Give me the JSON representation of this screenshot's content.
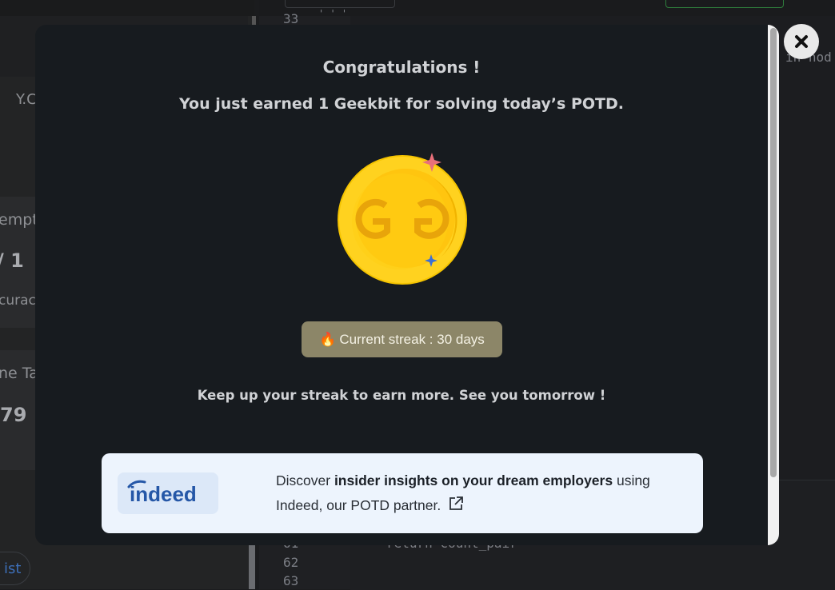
{
  "background": {
    "left_labels": [
      "Y.C",
      "empt",
      "/ 1",
      "curacy",
      "ne Ta",
      "79"
    ],
    "left_pill": "ist",
    "line_numbers": [
      "33",
      "61",
      "62",
      "63"
    ],
    "code_top": "' ' '",
    "code_right": "in nod",
    "code_bottom": "return count_pair"
  },
  "modal": {
    "title": "Congratulations !",
    "subtitle": "You just earned 1 Geekbit for solving today’s POTD.",
    "coin_icon": "geekbit-coin-icon",
    "streak": {
      "icon": "fire-icon",
      "emoji": "🔥",
      "label": "Current streak : 30 days"
    },
    "encouragement": "Keep up your streak to earn more. See you tomorrow !",
    "partner": {
      "logo_text": "indeed",
      "text_before": "Discover ",
      "text_bold": "insider insights on your dream employers",
      "text_after": " using Indeed, our POTD partner.",
      "link_icon": "external-link-icon"
    },
    "close_icon": "close-icon"
  },
  "colors": {
    "modal_bg": "#171b1f",
    "streak_bg": "#8c8668",
    "coin": "#ffd21f",
    "partner_bg": "#edf4fd",
    "indeed_blue": "#2557a7"
  }
}
